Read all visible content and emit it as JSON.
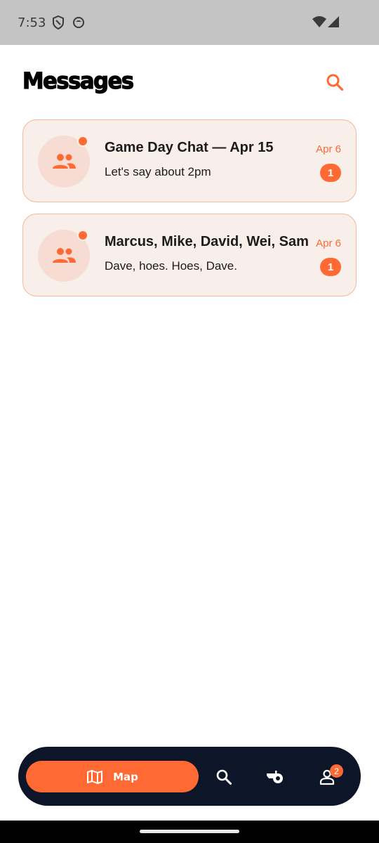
{
  "status_bar": {
    "time": "7:53"
  },
  "header": {
    "title": "Messages"
  },
  "conversations": [
    {
      "title": "Game Day Chat — Apr 15",
      "preview": "Let's say about 2pm",
      "date": "Apr 6",
      "unread": "1"
    },
    {
      "title": "Marcus, Mike, David, Wei, Sam",
      "preview": "Dave, hoes. Hoes, Dave.",
      "date": "Apr 6",
      "unread": "1"
    }
  ],
  "bottom_nav": {
    "map_label": "Map",
    "profile_badge": "2",
    "icons": [
      "map-icon",
      "search-icon",
      "whistle-icon",
      "profile-icon"
    ]
  },
  "colors": {
    "accent": "#ff6a34",
    "nav_bg": "#0d1628",
    "card_bg": "#f8eeea",
    "card_border": "#f6b79c"
  }
}
